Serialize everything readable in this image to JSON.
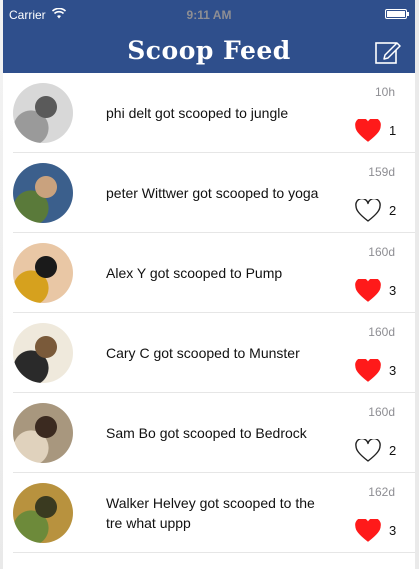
{
  "status_bar": {
    "carrier": "Carrier",
    "time": "9:11 AM"
  },
  "header": {
    "title": "Scoop Feed",
    "compose_icon": "compose-icon"
  },
  "colors": {
    "nav_bar": "#2f4f8c",
    "heart_active": "#ff1a1a",
    "timestamp": "#8e8e93"
  },
  "feed": [
    {
      "message": "phi delt got scooped to jungle",
      "time": "10h",
      "liked": true,
      "likes": "1"
    },
    {
      "message": "peter Wittwer got scooped to yoga",
      "time": "159d",
      "liked": false,
      "likes": "2"
    },
    {
      "message": "Alex Y got scooped to Pump",
      "time": "160d",
      "liked": true,
      "likes": "3"
    },
    {
      "message": "Cary C got scooped to Munster",
      "time": "160d",
      "liked": true,
      "likes": "3"
    },
    {
      "message": "Sam Bo got scooped to Bedrock",
      "time": "160d",
      "liked": false,
      "likes": "2"
    },
    {
      "message": "Walker Helvey got scooped to the tre what uppp",
      "time": "162d",
      "liked": true,
      "likes": "3"
    }
  ]
}
